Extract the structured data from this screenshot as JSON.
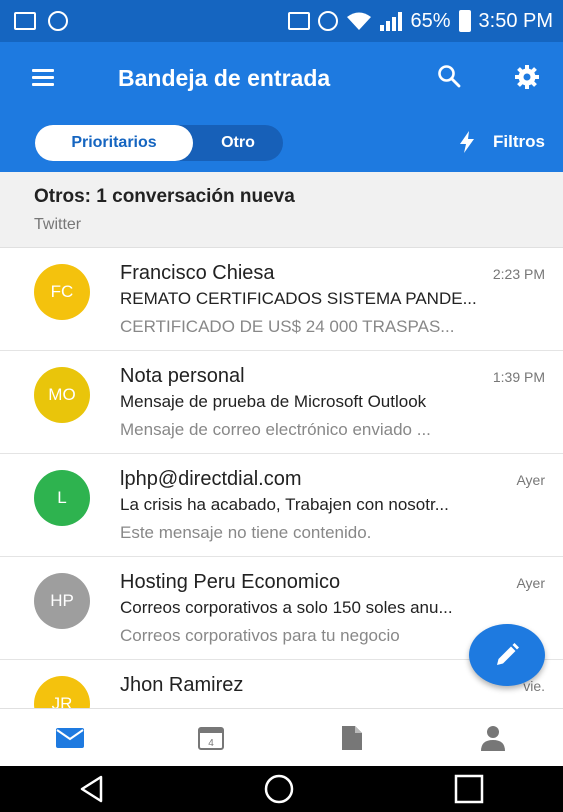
{
  "status_bar": {
    "battery": "65%",
    "time": "3:50 PM"
  },
  "app_bar": {
    "title": "Bandeja de entrada"
  },
  "filter_bar": {
    "focused_label": "Prioritarios",
    "other_label": "Otro",
    "filters_label": "Filtros"
  },
  "others_banner": {
    "title": "Otros: 1 conversación nueva",
    "subtitle": "Twitter"
  },
  "messages": [
    {
      "initials": "FC",
      "avatar_color": "#f4c20d",
      "sender": "Francisco Chiesa",
      "time": "2:23 PM",
      "subject": "REMATO CERTIFICADOS SISTEMA PANDE...",
      "preview": "CERTIFICADO DE US$ 24 000 TRASPAS..."
    },
    {
      "initials": "MO",
      "avatar_color": "#e9c50b",
      "sender": "Nota personal",
      "time": "1:39 PM",
      "subject": "Mensaje de prueba de Microsoft Outlook",
      "preview": "Mensaje de correo electrónico enviado ..."
    },
    {
      "initials": "L",
      "avatar_color": "#2eb34f",
      "sender": "lphp@directdial.com",
      "time": "Ayer",
      "subject": "La crisis ha acabado, Trabajen con nosotr...",
      "preview": "Este mensaje no tiene contenido."
    },
    {
      "initials": "HP",
      "avatar_color": "#9e9e9e",
      "sender": "Hosting Peru Economico",
      "time": "Ayer",
      "subject": "Correos corporativos a solo 150 soles anu...",
      "preview": "Correos corporativos para tu negocio"
    },
    {
      "initials": "JR",
      "avatar_color": "#f4c20d",
      "sender": "Jhon Ramirez",
      "time": "vie.",
      "subject": "",
      "preview": ""
    }
  ],
  "bottom_nav": {
    "mail_icon": "mail-icon",
    "calendar_icon": "calendar-icon",
    "calendar_day": "4",
    "files_icon": "file-icon",
    "people_icon": "person-icon"
  },
  "colors": {
    "status_bar": "#1565c0",
    "app_bar": "#1e7ae0",
    "accent": "#1e7ae0"
  }
}
